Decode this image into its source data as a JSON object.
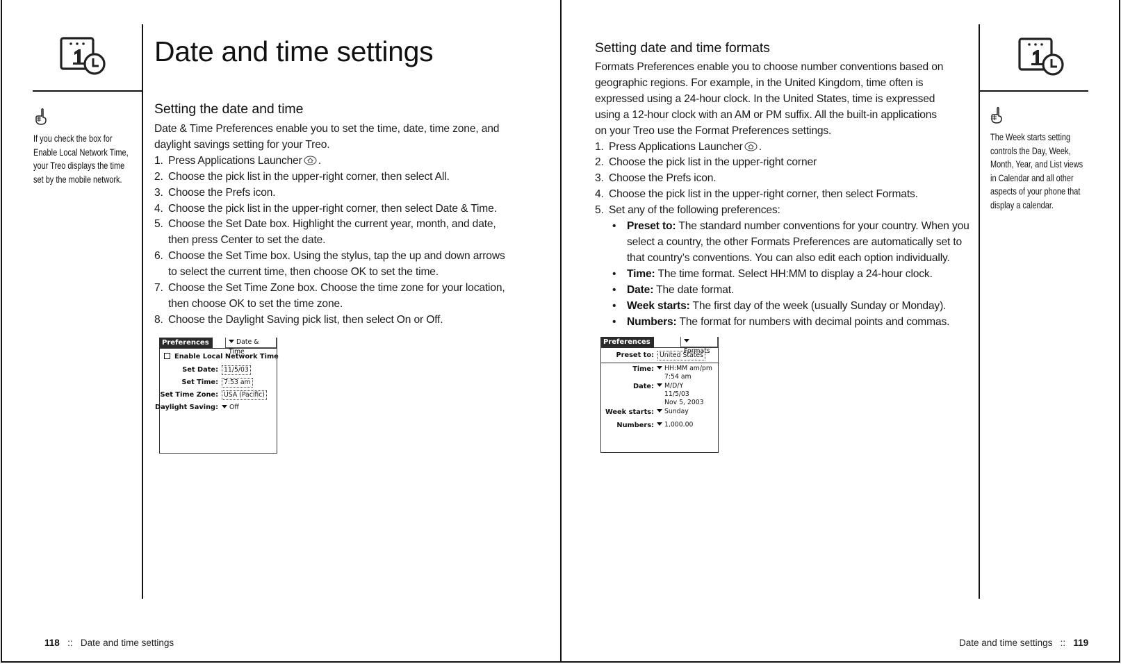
{
  "left_page": {
    "title": "Date and time settings",
    "sidenote": {
      "icon": "pointing-hand-tip-icon",
      "lines": [
        "If you check the box for",
        "Enable Local Network Time,",
        "your Treo displays the time",
        "set by the mobile network."
      ]
    },
    "section": {
      "heading": "Setting the date and time",
      "intro_lines": [
        "Date & Time Preferences enable you to set the time, date, time zone, and",
        "daylight savings setting for your Treo."
      ],
      "steps": [
        {
          "num": "1.",
          "lines": [
            "Press Applications Launcher",
            "."
          ],
          "icon": "applications-launcher-icon"
        },
        {
          "num": "2.",
          "lines": [
            "Choose the pick list in the upper-right corner, then select All."
          ]
        },
        {
          "num": "3.",
          "lines": [
            "Choose the Prefs icon."
          ]
        },
        {
          "num": "4.",
          "lines": [
            "Choose the pick list in the upper-right corner, then select Date & Time."
          ]
        },
        {
          "num": "5.",
          "lines": [
            "Choose the Set Date box. Highlight the current year, month, and date,",
            "then press Center to set the date."
          ]
        },
        {
          "num": "6.",
          "lines": [
            "Choose the Set Time box. Using the stylus, tap the up and down arrows",
            "to select the current time, then choose OK to set the time."
          ]
        },
        {
          "num": "7.",
          "lines": [
            "Choose the Set Time Zone box. Choose the time zone for your location,",
            "then choose OK to set the time zone."
          ]
        },
        {
          "num": "8.",
          "lines": [
            "Choose the Daylight Saving pick list, then select On or Off."
          ]
        }
      ]
    },
    "screenshot": {
      "tab": "Preferences",
      "picklist": "Date & Time",
      "checkbox_label": "Enable Local Network Time",
      "checkbox_checked": false,
      "rows": [
        {
          "label": "Set Date:",
          "value": "11/5/03"
        },
        {
          "label": "Set Time:",
          "value": "7:53 am"
        },
        {
          "label": "Set Time Zone:",
          "value": "USA (Pacific)"
        },
        {
          "label": "Daylight Saving:",
          "value": "Off"
        }
      ]
    },
    "footer": {
      "page_number": "118",
      "separator": "::",
      "section": "Date and time settings"
    }
  },
  "right_page": {
    "sidenote": {
      "icon": "pointing-hand-tip-icon",
      "lines": [
        "The Week starts setting",
        "controls the Day, Week,",
        "Month, Year, and List views",
        "in Calendar and all other",
        "aspects of your phone that",
        "display a calendar."
      ]
    },
    "section": {
      "heading": "Setting date and time formats",
      "intro_lines": [
        "Formats Preferences enable you to choose number conventions based on",
        "geographic regions. For example, in the United Kingdom, time often is",
        "expressed using a 24-hour clock. In the United States, time is expressed",
        "using a 12-hour clock with an AM or PM suffix. All the built-in applications",
        "on your Treo use the Format Preferences settings."
      ],
      "steps": [
        {
          "num": "1.",
          "lines": [
            "Press Applications Launcher",
            "."
          ],
          "icon": "applications-launcher-icon"
        },
        {
          "num": "2.",
          "lines": [
            "Choose the pick list in the upper-right corner"
          ]
        },
        {
          "num": "3.",
          "lines": [
            "Choose the Prefs icon."
          ]
        },
        {
          "num": "4.",
          "lines": [
            "Choose the pick list in the upper-right corner, then select Formats."
          ]
        },
        {
          "num": "5.",
          "lines": [
            "Set any of the following preferences:"
          ]
        }
      ],
      "bullets": [
        {
          "term": "Preset to:",
          "lines": [
            " The standard number conventions for your country. When you",
            "select a country, the other Formats Preferences are automatically set to",
            "that country’s conventions. You can also edit each option individually."
          ]
        },
        {
          "term": "Time:",
          "lines": [
            " The time format. Select HH:MM to display a 24-hour clock."
          ]
        },
        {
          "term": "Date:",
          "lines": [
            " The date format."
          ]
        },
        {
          "term": "Week starts:",
          "lines": [
            " The first day of the week (usually Sunday or Monday)."
          ]
        },
        {
          "term": "Numbers:",
          "lines": [
            " The format for numbers with decimal points and commas."
          ]
        }
      ]
    },
    "screenshot": {
      "tab": "Preferences",
      "picklist": "Formats",
      "preset_label": "Preset to:",
      "preset_value": "United States",
      "rows": [
        {
          "label": "Time:",
          "values": [
            "HH:MM am/pm",
            "7:54 am"
          ]
        },
        {
          "label": "Date:",
          "values": [
            "M/D/Y",
            "11/5/03",
            "Nov 5, 2003"
          ]
        },
        {
          "label": "Week starts:",
          "values": [
            "Sunday"
          ]
        },
        {
          "label": "Numbers:",
          "values": [
            "1,000.00"
          ]
        }
      ]
    },
    "footer": {
      "section": "Date and time settings",
      "separator": "::",
      "page_number": "119"
    }
  },
  "icons": {
    "chapter": "calendar-clock-icon",
    "tip": "pointing-hand-tip-icon",
    "launcher": "applications-launcher-icon"
  }
}
